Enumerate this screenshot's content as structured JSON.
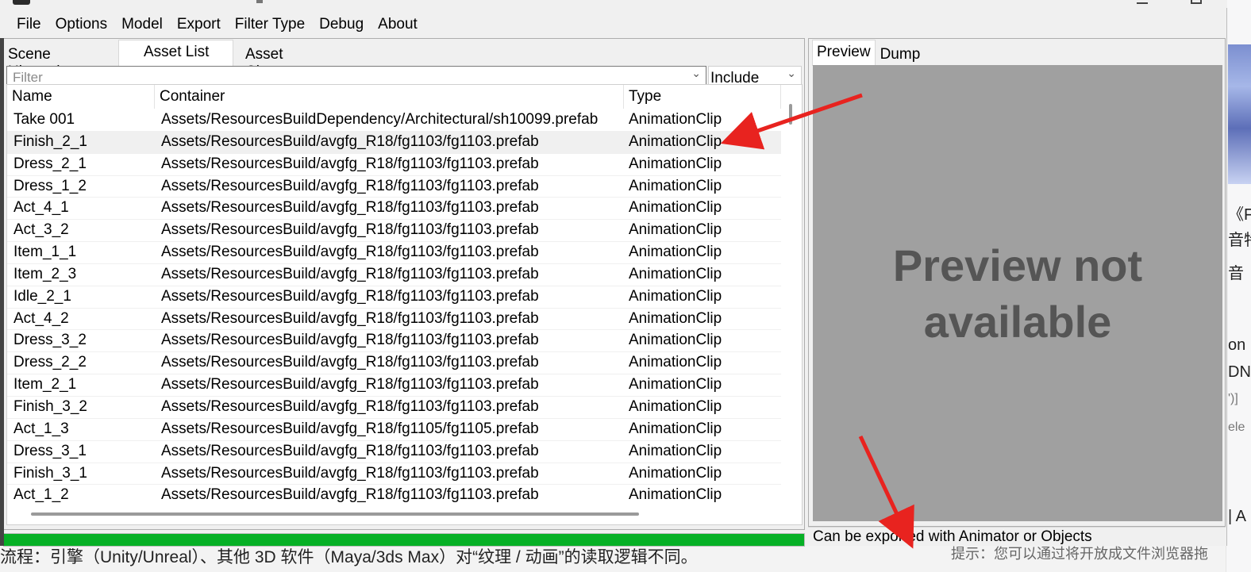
{
  "menubar": {
    "items": [
      "File",
      "Options",
      "Model",
      "Export",
      "Filter Type",
      "Debug",
      "About"
    ]
  },
  "left_tabs": [
    "Scene Hierarchy",
    "Asset List",
    "Asset Classes"
  ],
  "filter": {
    "placeholder": "Filter",
    "include_value": "Include"
  },
  "table": {
    "columns": [
      "Name",
      "Container",
      "Type"
    ],
    "rows": [
      [
        "Take 001",
        "Assets/ResourcesBuildDependency/Architectural/sh10099.prefab",
        "AnimationClip"
      ],
      [
        "Finish_2_1",
        "Assets/ResourcesBuild/avgfg_R18/fg1103/fg1103.prefab",
        "AnimationClip"
      ],
      [
        "Dress_2_1",
        "Assets/ResourcesBuild/avgfg_R18/fg1103/fg1103.prefab",
        "AnimationClip"
      ],
      [
        "Dress_1_2",
        "Assets/ResourcesBuild/avgfg_R18/fg1103/fg1103.prefab",
        "AnimationClip"
      ],
      [
        "Act_4_1",
        "Assets/ResourcesBuild/avgfg_R18/fg1103/fg1103.prefab",
        "AnimationClip"
      ],
      [
        "Act_3_2",
        "Assets/ResourcesBuild/avgfg_R18/fg1103/fg1103.prefab",
        "AnimationClip"
      ],
      [
        "Item_1_1",
        "Assets/ResourcesBuild/avgfg_R18/fg1103/fg1103.prefab",
        "AnimationClip"
      ],
      [
        "Item_2_3",
        "Assets/ResourcesBuild/avgfg_R18/fg1103/fg1103.prefab",
        "AnimationClip"
      ],
      [
        "Idle_2_1",
        "Assets/ResourcesBuild/avgfg_R18/fg1103/fg1103.prefab",
        "AnimationClip"
      ],
      [
        "Act_4_2",
        "Assets/ResourcesBuild/avgfg_R18/fg1103/fg1103.prefab",
        "AnimationClip"
      ],
      [
        "Dress_3_2",
        "Assets/ResourcesBuild/avgfg_R18/fg1103/fg1103.prefab",
        "AnimationClip"
      ],
      [
        "Dress_2_2",
        "Assets/ResourcesBuild/avgfg_R18/fg1103/fg1103.prefab",
        "AnimationClip"
      ],
      [
        "Item_2_1",
        "Assets/ResourcesBuild/avgfg_R18/fg1103/fg1103.prefab",
        "AnimationClip"
      ],
      [
        "Finish_3_2",
        "Assets/ResourcesBuild/avgfg_R18/fg1103/fg1103.prefab",
        "AnimationClip"
      ],
      [
        "Act_1_3",
        "Assets/ResourcesBuild/avgfg_R18/fg1105/fg1105.prefab",
        "AnimationClip"
      ],
      [
        "Dress_3_1",
        "Assets/ResourcesBuild/avgfg_R18/fg1103/fg1103.prefab",
        "AnimationClip"
      ],
      [
        "Finish_3_1",
        "Assets/ResourcesBuild/avgfg_R18/fg1103/fg1103.prefab",
        "AnimationClip"
      ],
      [
        "Act_1_2",
        "Assets/ResourcesBuild/avgfg_R18/fg1103/fg1103.prefab",
        "AnimationClip"
      ]
    ],
    "selected_row": 1
  },
  "progress": {
    "value": 1.0,
    "color": "#06b025"
  },
  "right_tabs": [
    "Preview",
    "Dump"
  ],
  "preview": {
    "message": "Preview not available"
  },
  "status": {
    "text": "Can be exported with Animator or Objects"
  },
  "background": {
    "bottom_text": "流程：引擎（Unity/Unreal）、其他 3D 软件（Maya/3ds Max）对“纹理 / 动画”的读取逻辑不同。",
    "right_text": "提示：您可以通过将开放成文件浏览器拖",
    "right_snippets": [
      "《F",
      "音特",
      "音",
      "on",
      "DN",
      "')]",
      "ele",
      "| A"
    ]
  },
  "colors": {
    "annotation_arrow": "#e8231f",
    "preview_bg": "#a0a0a0",
    "selected_row": "#f0f0f0"
  }
}
